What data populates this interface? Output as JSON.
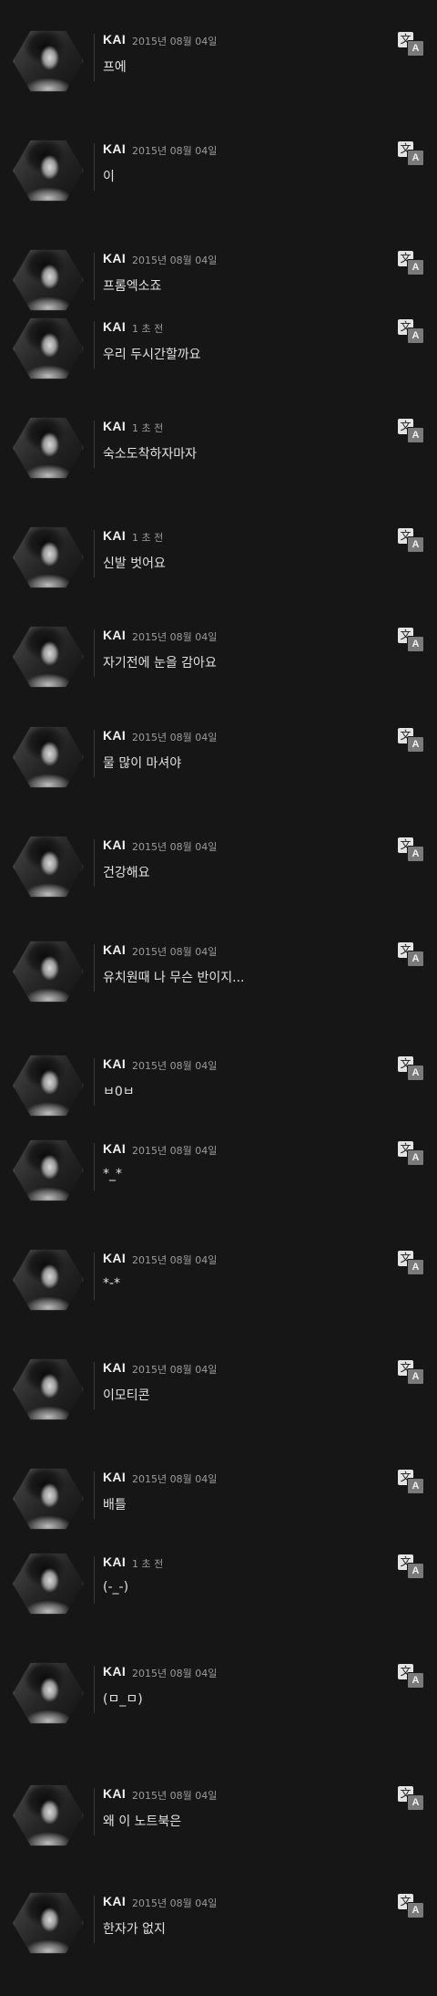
{
  "icons": {
    "translate_back_glyph": "文",
    "translate_front_glyph": "A"
  },
  "messages": [
    {
      "name": "KAI",
      "time": "2015년 08월 04일",
      "text": "프에"
    },
    {
      "name": "KAI",
      "time": "2015년 08월 04일",
      "text": "이"
    },
    {
      "name": "KAI",
      "time": "2015년 08월 04일",
      "text": "프롬엑소죠"
    },
    {
      "name": "KAI",
      "time": "1 초 전",
      "text": "우리 두시간할까요"
    },
    {
      "name": "KAI",
      "time": "1 초 전",
      "text": "숙소도착하자마자"
    },
    {
      "name": "KAI",
      "time": "1 초 전",
      "text": "신발 벗어요"
    },
    {
      "name": "KAI",
      "time": "2015년 08월 04일",
      "text": "자기전에 눈을 감아요"
    },
    {
      "name": "KAI",
      "time": "2015년 08월 04일",
      "text": "물 많이 마셔야"
    },
    {
      "name": "KAI",
      "time": "2015년 08월 04일",
      "text": "건강해요"
    },
    {
      "name": "KAI",
      "time": "2015년 08월 04일",
      "text": "유치원때 나 무슨 반이지..."
    },
    {
      "name": "KAI",
      "time": "2015년 08월 04일",
      "text": "ㅂ0ㅂ"
    },
    {
      "name": "KAI",
      "time": "2015년 08월 04일",
      "text": "*_*"
    },
    {
      "name": "KAI",
      "time": "2015년 08월 04일",
      "text": "*-*"
    },
    {
      "name": "KAI",
      "time": "2015년 08월 04일",
      "text": "이모티콘"
    },
    {
      "name": "KAI",
      "time": "2015년 08월 04일",
      "text": "배틀"
    },
    {
      "name": "KAI",
      "time": "1 초 전",
      "text": "(-_-)"
    },
    {
      "name": "KAI",
      "time": "2015년 08월 04일",
      "text": "(ㅁ_ㅁ)"
    },
    {
      "name": "KAI",
      "time": "2015년 08월 04일",
      "text": "왜 이 노트북은"
    },
    {
      "name": "KAI",
      "time": "2015년 08월 04일",
      "text": "한자가 없지"
    }
  ]
}
